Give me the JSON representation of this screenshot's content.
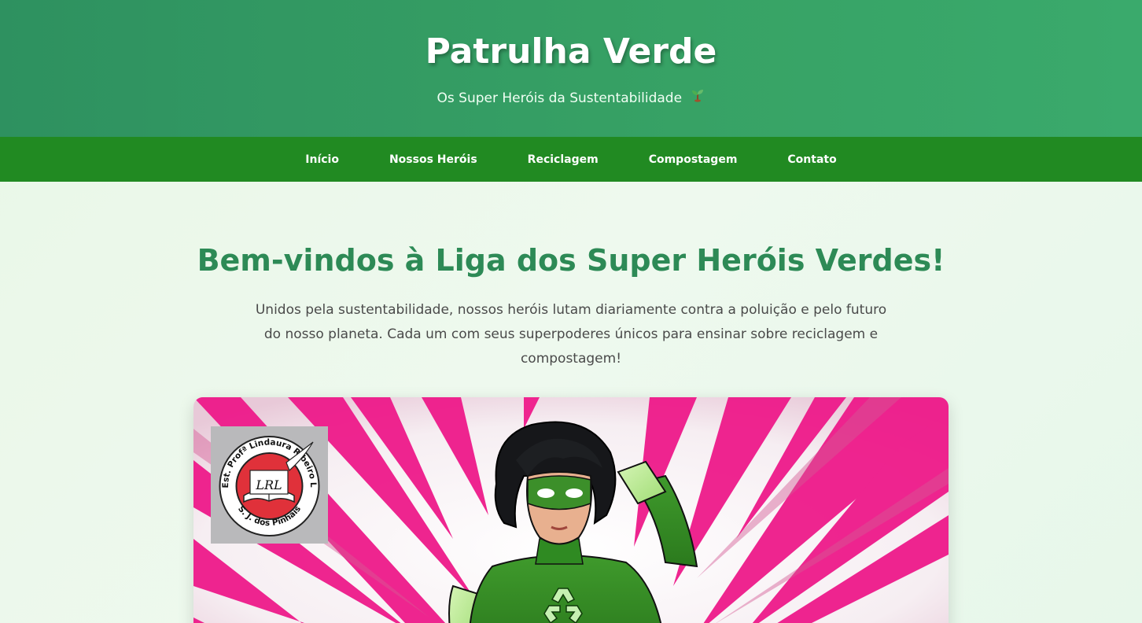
{
  "header": {
    "title": "Patrulha Verde",
    "subtitle": "Os Super Heróis da Sustentabilidade",
    "subtitle_icon": "sprout-icon"
  },
  "nav": {
    "items": [
      {
        "label": "Início"
      },
      {
        "label": "Nossos Heróis"
      },
      {
        "label": "Reciclagem"
      },
      {
        "label": "Compostagem"
      },
      {
        "label": "Contato"
      }
    ]
  },
  "main": {
    "title": "Bem-vindos à Liga dos Super Heróis Verdes!",
    "intro": "Unidos pela sustentabilidade, nossos heróis lutam diariamente contra a poluição e pelo futuro do nosso planeta. Cada um com seus superpoderes únicos para ensinar sobre reciclagem e compostagem!"
  },
  "logo": {
    "ring_text": "Col. Est. Profª Lindaura Ribeiro Lucas",
    "city_text": "S. J. dos Pinhais",
    "monogram": "LRL"
  },
  "colors": {
    "header_green": "#37a265",
    "nav_green": "#218a22",
    "title_green": "#2d8a56",
    "burst_pink": "#ee1a8a"
  }
}
